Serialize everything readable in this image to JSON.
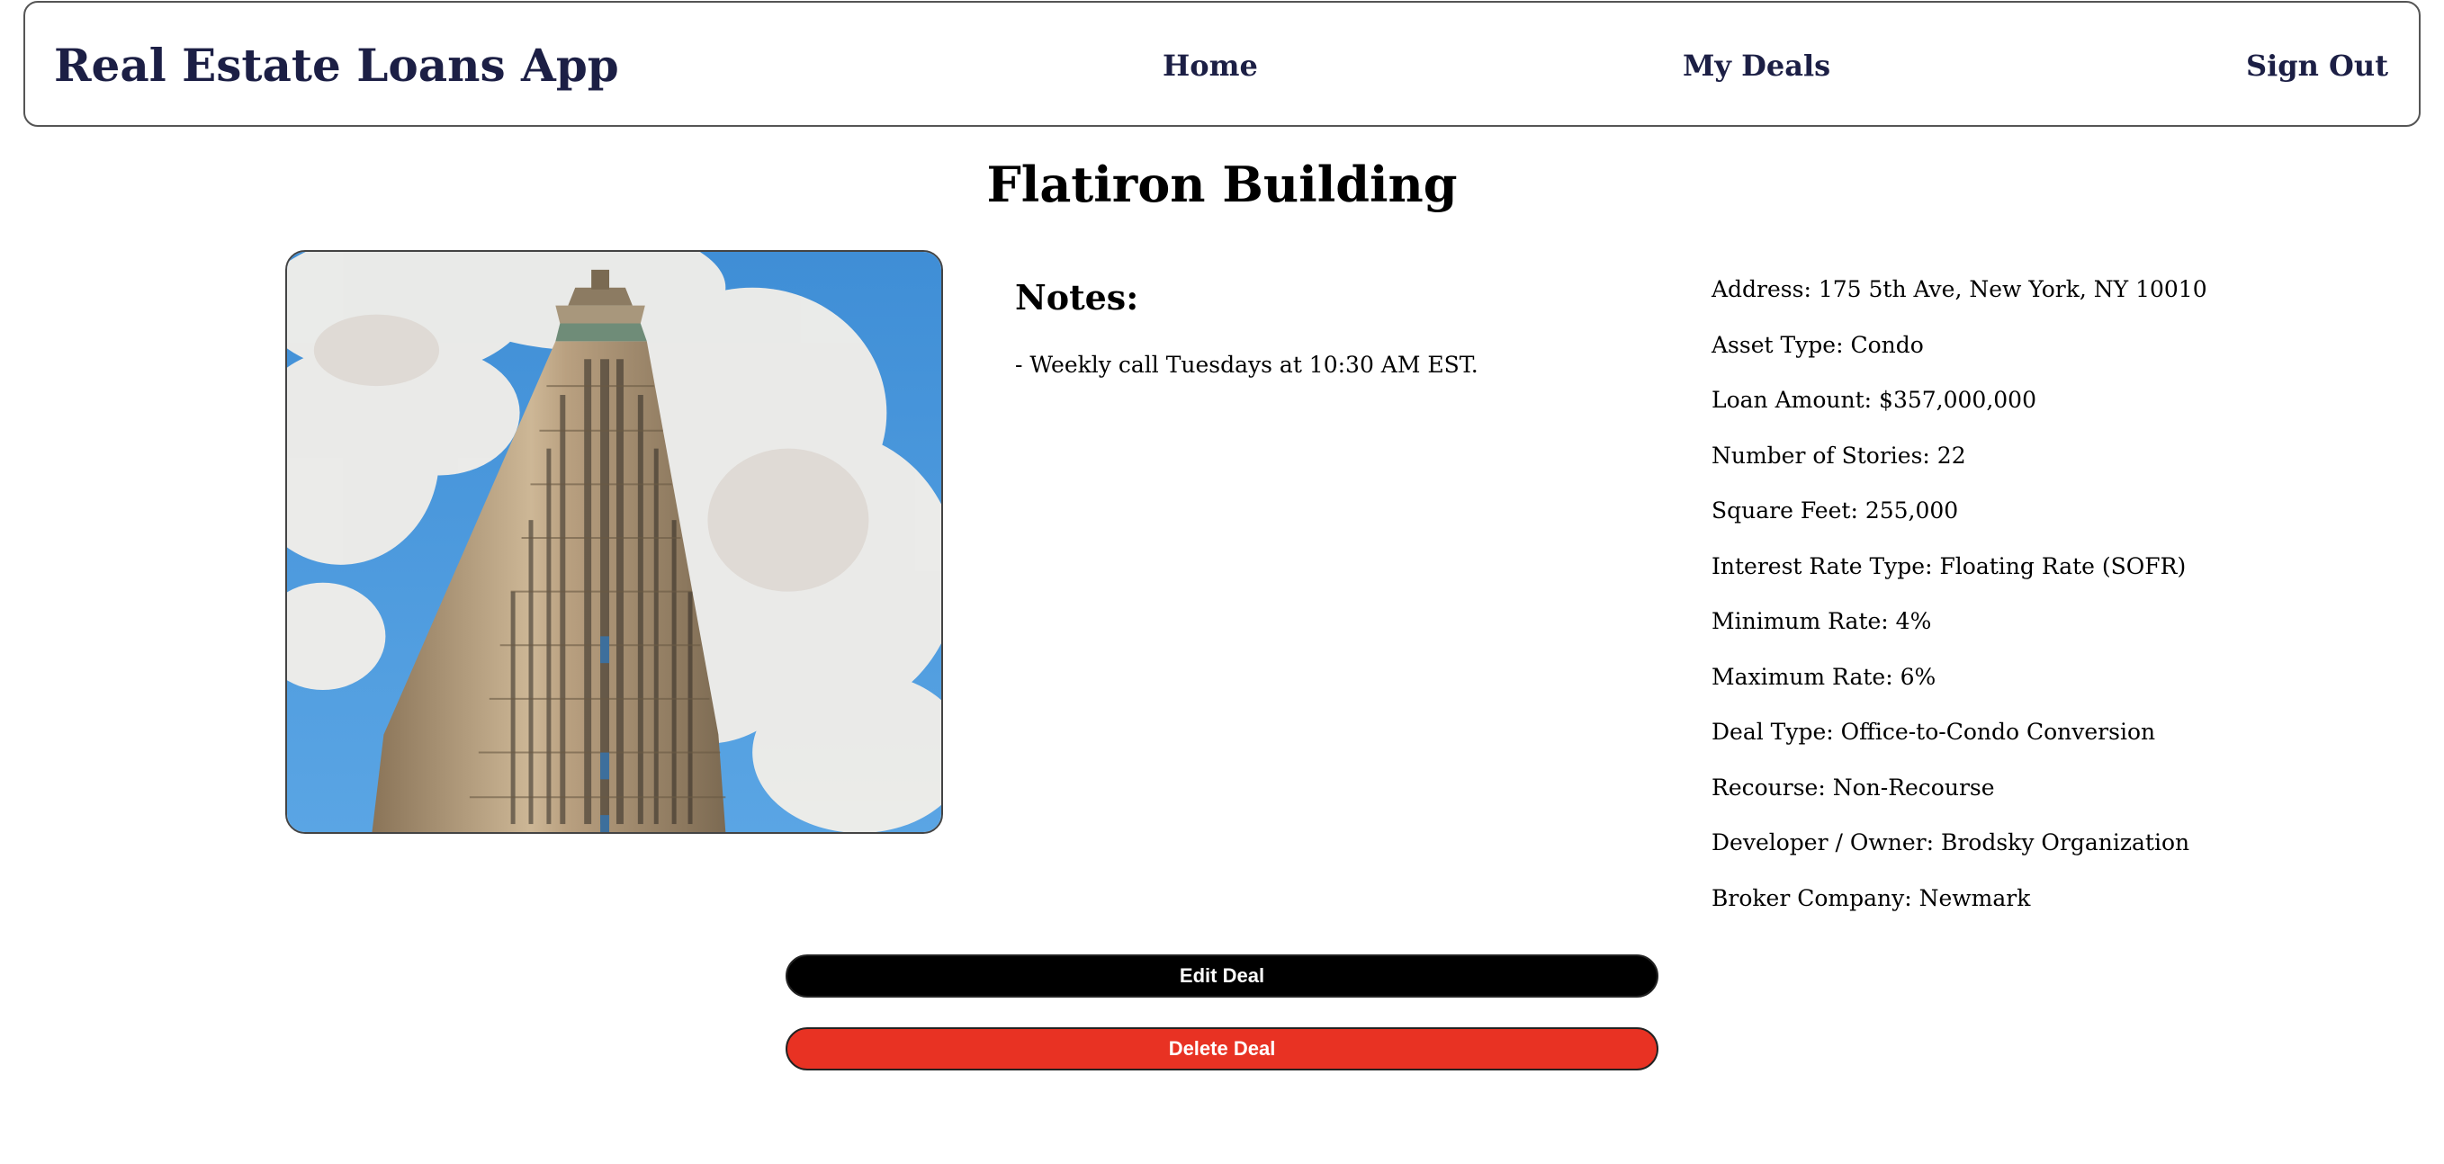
{
  "header": {
    "brand": "Real Estate Loans App",
    "nav": {
      "home": "Home",
      "my_deals": "My Deals",
      "sign_out": "Sign Out"
    }
  },
  "deal": {
    "title": "Flatiron Building",
    "notes_heading": "Notes:",
    "notes": "- Weekly call Tuesdays at 10:30 AM EST.",
    "details": [
      "Address: 175 5th Ave, New York, NY 10010",
      "Asset Type: Condo",
      "Loan Amount: $357,000,000",
      "Number of Stories: 22",
      "Square Feet: 255,000",
      "Interest Rate Type: Floating Rate (SOFR)",
      "Minimum Rate: 4%",
      "Maximum Rate: 6%",
      "Deal Type: Office-to-Condo Conversion",
      "Recourse: Non-Recourse",
      "Developer / Owner: Brodsky Organization",
      "Broker Company: Newmark"
    ]
  },
  "actions": {
    "edit": "Edit Deal",
    "delete": "Delete Deal"
  },
  "colors": {
    "brand_text": "#1c1f45",
    "edit_button": "#000000",
    "delete_button": "#e83223"
  }
}
